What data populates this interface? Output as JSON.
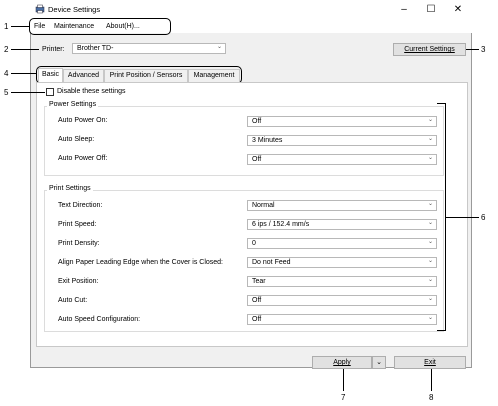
{
  "window": {
    "title": "Device Settings"
  },
  "menu": {
    "file": "File",
    "maintenance": "Maintenance",
    "about": "About(H)..."
  },
  "printer": {
    "label": "Printer:",
    "value": "Brother TD-"
  },
  "current_settings_label": "Current Settings",
  "tabs": [
    "Basic",
    "Advanced",
    "Print Position / Sensors",
    "Management"
  ],
  "disable_label": "Disable these settings",
  "power": {
    "title": "Power Settings",
    "rows": [
      {
        "label": "Auto Power On:",
        "value": "Off"
      },
      {
        "label": "Auto Sleep:",
        "value": "3 Minutes"
      },
      {
        "label": "Auto Power Off:",
        "value": "Off"
      }
    ]
  },
  "print": {
    "title": "Print Settings",
    "rows": [
      {
        "label": "Text Direction:",
        "value": "Normal"
      },
      {
        "label": "Print Speed:",
        "value": "6 ips / 152.4 mm/s"
      },
      {
        "label": "Print Density:",
        "value": "0"
      },
      {
        "label": "Align Paper Leading Edge when the Cover is Closed:",
        "value": "Do not Feed"
      },
      {
        "label": "Exit Position:",
        "value": "Tear"
      },
      {
        "label": "Auto Cut:",
        "value": "Off"
      },
      {
        "label": "Auto Speed Configuration:",
        "value": "Off"
      }
    ]
  },
  "buttons": {
    "apply": "Apply",
    "exit": "Exit"
  },
  "callouts": [
    "1",
    "2",
    "3",
    "4",
    "5",
    "6",
    "7",
    "8"
  ]
}
